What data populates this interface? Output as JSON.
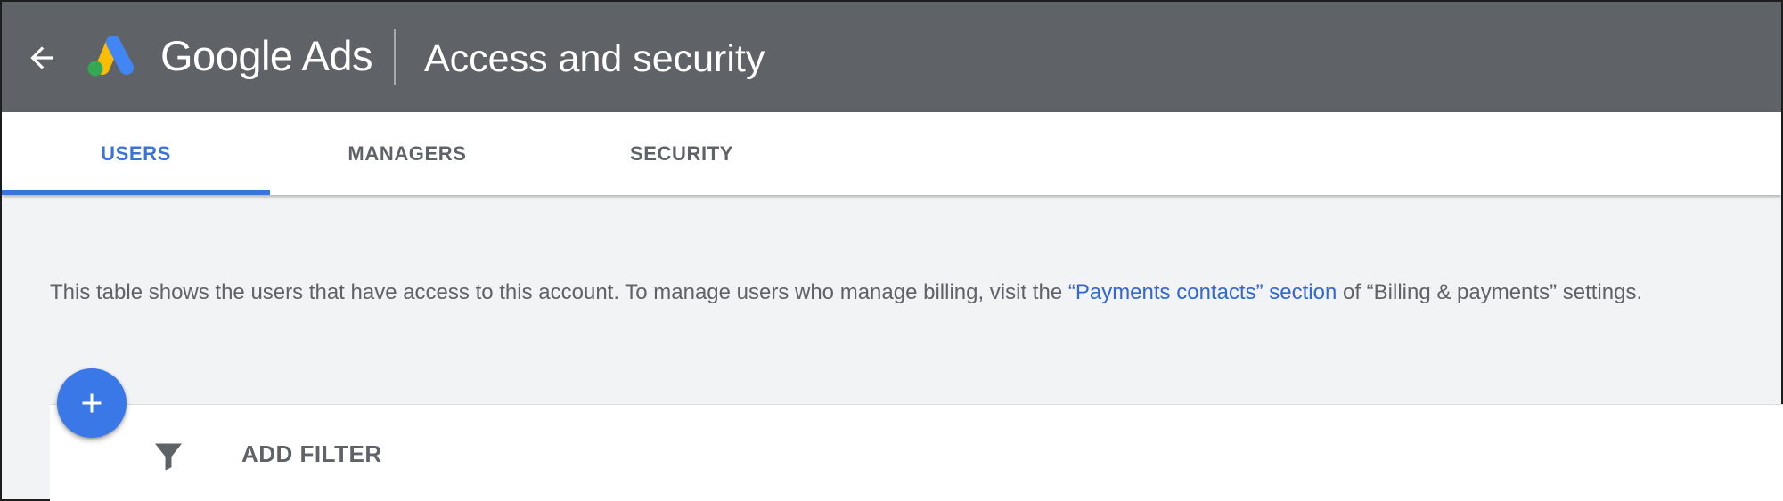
{
  "header": {
    "back_icon": "arrow-back-icon",
    "logo_icon": "google-ads-logo-icon",
    "brand": "Google Ads",
    "title": "Access and security"
  },
  "tabs": [
    {
      "label": "USERS",
      "selected": true
    },
    {
      "label": "MANAGERS",
      "selected": false
    },
    {
      "label": "SECURITY",
      "selected": false
    }
  ],
  "info": {
    "text_before": "This table shows the users that have access to this account. To manage users who manage billing, visit the ",
    "link": "“Payments contacts” section",
    "text_after": " of “Billing & payments” settings."
  },
  "toolbar": {
    "add_icon": "plus-icon",
    "filter_icon": "filter-icon",
    "filter_label": "ADD FILTER"
  },
  "colors": {
    "header_bg": "#5f6368",
    "accent": "#3b73d8",
    "fab": "#3b78e7",
    "page_bg": "#f1f3f4",
    "logo_blue": "#4285f4",
    "logo_yellow": "#fbbc04",
    "logo_green": "#34a853"
  }
}
